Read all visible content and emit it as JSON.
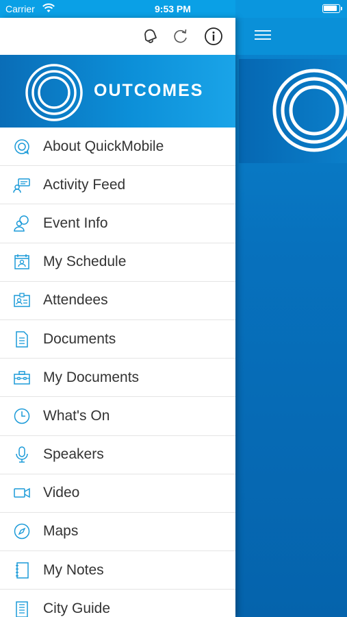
{
  "status_bar": {
    "carrier": "Carrier",
    "time": "9:53 PM"
  },
  "banner": {
    "brand_text": "OUTCOMES"
  },
  "toolbar": {
    "icons": [
      "bell-icon",
      "refresh-icon",
      "info-icon"
    ]
  },
  "colors": {
    "accent": "#0a90d8",
    "banner_dark": "#0a6db7",
    "icon_blue": "#1a9ad8",
    "text": "#333333"
  },
  "menu": {
    "items": [
      {
        "label": "About QuickMobile",
        "icon": "quickmobile-icon"
      },
      {
        "label": "Activity Feed",
        "icon": "activity-feed-icon"
      },
      {
        "label": "Event Info",
        "icon": "event-info-icon"
      },
      {
        "label": "My Schedule",
        "icon": "calendar-icon"
      },
      {
        "label": "Attendees",
        "icon": "attendees-icon"
      },
      {
        "label": "Documents",
        "icon": "document-icon"
      },
      {
        "label": "My Documents",
        "icon": "briefcase-icon"
      },
      {
        "label": "What's On",
        "icon": "clock-icon"
      },
      {
        "label": "Speakers",
        "icon": "microphone-icon"
      },
      {
        "label": "Video",
        "icon": "video-camera-icon"
      },
      {
        "label": "Maps",
        "icon": "compass-icon"
      },
      {
        "label": "My Notes",
        "icon": "notebook-icon"
      },
      {
        "label": "City Guide",
        "icon": "building-icon"
      }
    ]
  }
}
